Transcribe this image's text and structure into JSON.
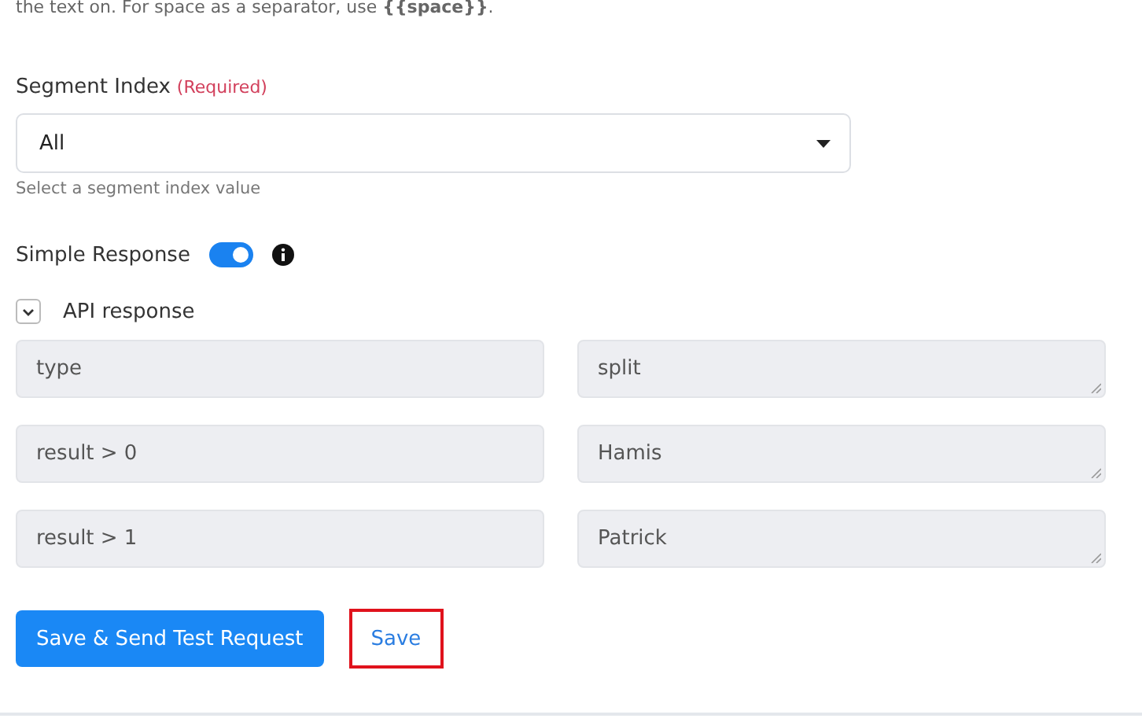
{
  "hint_text": "the text on. For space as a separator, use **{{space}}**.",
  "segment_index": {
    "label": "Segment Index",
    "required": "(Required)",
    "value": "All",
    "help": "Select a segment index value"
  },
  "simple_response": {
    "label": "Simple Response",
    "on": true
  },
  "api_response": {
    "label": "API response",
    "expanded": true,
    "rows": [
      {
        "key": "type",
        "value": "split"
      },
      {
        "key": "result > 0",
        "value": "Hamis"
      },
      {
        "key": "result > 1",
        "value": "Patrick"
      }
    ]
  },
  "buttons": [
    {
      "label": "Save & Send Test Request",
      "kind": "primary"
    },
    {
      "label": "Save",
      "kind": "link",
      "highlighted": true
    }
  ]
}
